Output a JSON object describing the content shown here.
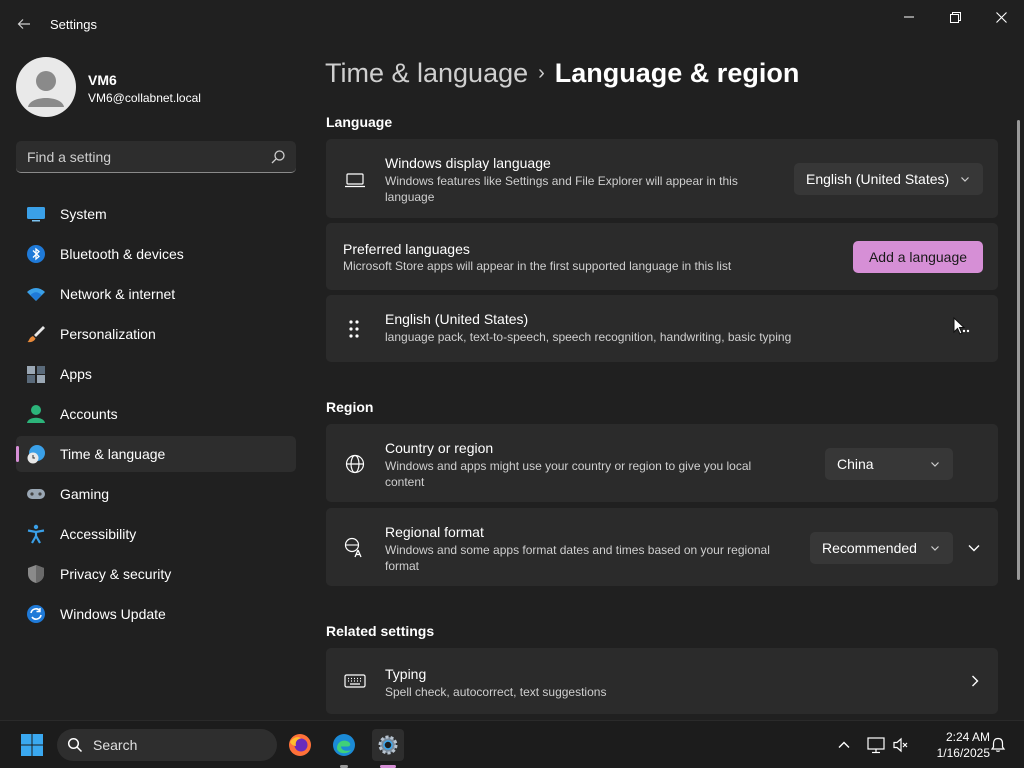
{
  "window": {
    "title": "Settings"
  },
  "profile": {
    "name": "VM6",
    "email": "VM6@collabnet.local"
  },
  "search": {
    "placeholder": "Find a setting"
  },
  "nav": [
    {
      "label": "System",
      "icon": "system-icon"
    },
    {
      "label": "Bluetooth & devices",
      "icon": "bluetooth-icon"
    },
    {
      "label": "Network & internet",
      "icon": "wifi-icon"
    },
    {
      "label": "Personalization",
      "icon": "brush-icon"
    },
    {
      "label": "Apps",
      "icon": "apps-icon"
    },
    {
      "label": "Accounts",
      "icon": "accounts-icon"
    },
    {
      "label": "Time & language",
      "icon": "clock-globe-icon",
      "active": true
    },
    {
      "label": "Gaming",
      "icon": "gamepad-icon"
    },
    {
      "label": "Accessibility",
      "icon": "accessibility-icon"
    },
    {
      "label": "Privacy & security",
      "icon": "shield-icon"
    },
    {
      "label": "Windows Update",
      "icon": "update-icon"
    }
  ],
  "breadcrumb": {
    "parent": "Time & language",
    "current": "Language & region"
  },
  "language": {
    "section_title": "Language",
    "display": {
      "title": "Windows display language",
      "desc_line1": "Windows features like Settings and File Explorer will appear in this",
      "desc_line2": "language",
      "value": "English (United States)"
    },
    "preferred": {
      "title": "Preferred languages",
      "desc": "Microsoft Store apps will appear in the first supported language in this list",
      "button": "Add a language"
    },
    "entry": {
      "title": "English (United States)",
      "desc": "language pack, text-to-speech, speech recognition, handwriting, basic typing"
    }
  },
  "region": {
    "section_title": "Region",
    "country": {
      "title": "Country or region",
      "desc_line1": "Windows and apps might use your country or region to give you local",
      "desc_line2": "content",
      "value": "China"
    },
    "format": {
      "title": "Regional format",
      "desc_line1": "Windows and some apps format dates and times based on your regional",
      "desc_line2": "format",
      "value": "Recommended"
    }
  },
  "related": {
    "section_title": "Related settings",
    "typing": {
      "title": "Typing",
      "desc": "Spell check, autocorrect, text suggestions"
    }
  },
  "taskbar": {
    "search_label": "Search",
    "time": "2:24 AM",
    "date": "1/16/2025"
  },
  "colors": {
    "accent": "#d68fd6",
    "background": "#202020",
    "card": "#2b2b2b"
  }
}
